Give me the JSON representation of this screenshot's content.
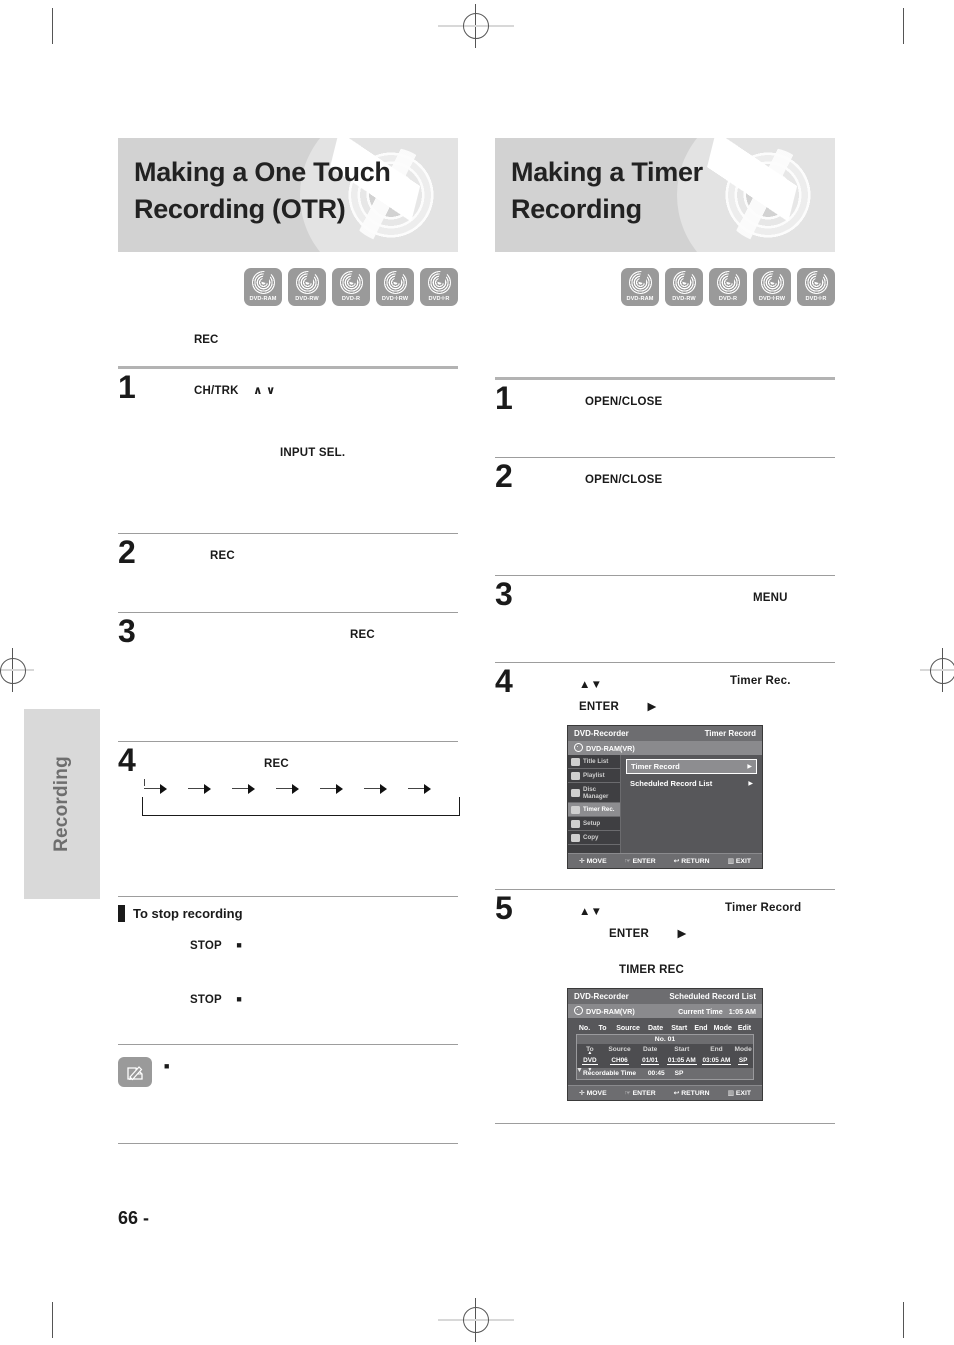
{
  "page": {
    "number": "66 -",
    "side_tab": "Recording"
  },
  "left": {
    "banner_title": "Making a One Touch\nRecording (OTR)",
    "banner_line1": "Making a One Touch",
    "banner_line2": "Recording (OTR)",
    "disc_logos": [
      "DVD-RAM",
      "DVD-RW",
      "DVD-R",
      "DVD✛RW",
      "DVD✛R"
    ],
    "intro_keyword": "REC",
    "steps": [
      {
        "num": "1",
        "kw1": "CH/TRK",
        "kw_arrows": "∧ ∨",
        "kw2": "INPUT SEL."
      },
      {
        "num": "2",
        "kw1": "REC"
      },
      {
        "num": "3",
        "kw1": "REC"
      },
      {
        "num": "4",
        "kw1": "REC"
      }
    ],
    "flow_arrow_count": 7,
    "stop_section": {
      "heading": "To stop recording",
      "kw1": "STOP",
      "kw1_glyph": "■",
      "kw2": "STOP",
      "kw2_glyph": "■"
    },
    "note": {
      "glyph": "■",
      "icon": "pencil-note-icon"
    }
  },
  "right": {
    "banner_line1": "Making a Timer",
    "banner_line2": "Recording",
    "disc_logos": [
      "DVD-RAM",
      "DVD-RW",
      "DVD-R",
      "DVD✛RW",
      "DVD✛R"
    ],
    "steps": [
      {
        "num": "1",
        "kw1": "OPEN/CLOSE"
      },
      {
        "num": "2",
        "kw1": "OPEN/CLOSE"
      },
      {
        "num": "3",
        "kw1": "MENU"
      },
      {
        "num": "4",
        "kw_updown": "▲▼",
        "kw_enter": "ENTER",
        "kw_right": "▶",
        "kw_target": "Timer Rec."
      },
      {
        "num": "5",
        "kw_updown": "▲▼",
        "kw_enter": "ENTER",
        "kw_right": "▶",
        "kw_target": "Timer Record",
        "kw_extra": "TIMER REC"
      }
    ],
    "osd_timer_record": {
      "title_left": "DVD-Recorder",
      "title_right": "Timer Record",
      "disc_label": "DVD-RAM(VR)",
      "sidebar": [
        {
          "label": "Title List",
          "icon": "title-list-icon",
          "selected": false
        },
        {
          "label": "Playlist",
          "icon": "playlist-icon",
          "selected": false
        },
        {
          "label": "Disc Manager",
          "icon": "disc-manager-icon",
          "selected": false
        },
        {
          "label": "Timer Rec.",
          "icon": "timer-rec-icon",
          "selected": true
        },
        {
          "label": "Setup",
          "icon": "setup-gear-icon",
          "selected": false
        },
        {
          "label": "Copy",
          "icon": "copy-icon",
          "selected": false
        }
      ],
      "menu": [
        {
          "label": "Timer Record",
          "arrow": "▶",
          "selected": true
        },
        {
          "label": "Scheduled Record List",
          "arrow": "▶",
          "selected": false
        }
      ],
      "bottom_bar": [
        {
          "icon": "move-dpad-icon",
          "label": "MOVE"
        },
        {
          "icon": "enter-icon",
          "label": "ENTER"
        },
        {
          "icon": "return-icon",
          "label": "RETURN"
        },
        {
          "icon": "exit-icon",
          "label": "EXIT"
        }
      ]
    },
    "osd_scheduled_list": {
      "title_left": "DVD-Recorder",
      "title_right": "Scheduled Record List",
      "disc_label": "DVD-RAM(VR)",
      "current_time_label": "Current Time",
      "current_time_value": "1:05 AM",
      "outer_headers": [
        "No.",
        "To",
        "Source",
        "Date",
        "Start",
        "End",
        "Mode",
        "Edit"
      ],
      "entry_no": "No. 01",
      "inner_headers": [
        "To",
        "Source",
        "Date",
        "Start",
        "End",
        "Mode"
      ],
      "row": {
        "to": "DVD",
        "source": "CH06",
        "date": "01/01",
        "start": "01:05 AM",
        "end": "03:05 AM",
        "mode": "SP"
      },
      "recordable_label": "Recordable Time",
      "recordable_value": "00:45",
      "recordable_mode": "SP",
      "bottom_bar": [
        {
          "icon": "move-dpad-icon",
          "label": "MOVE"
        },
        {
          "icon": "enter-icon",
          "label": "ENTER"
        },
        {
          "icon": "return-icon",
          "label": "RETURN"
        },
        {
          "icon": "exit-icon",
          "label": "EXIT"
        }
      ]
    }
  }
}
